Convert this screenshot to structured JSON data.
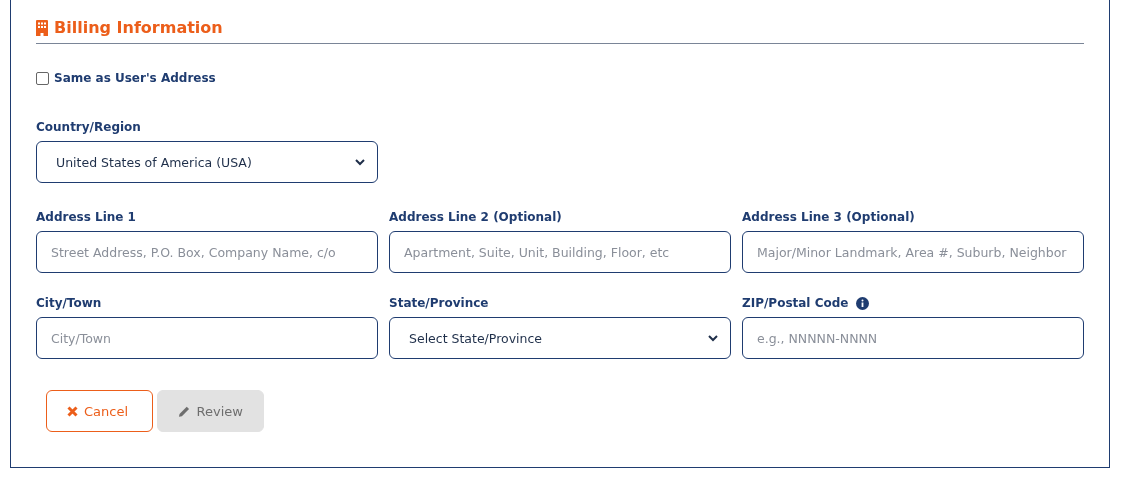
{
  "section": {
    "title": "Billing Information"
  },
  "same_address": {
    "label": "Same as User's Address",
    "checked": false
  },
  "country": {
    "label": "Country/Region",
    "kind": "select",
    "value": "United States of America (USA)"
  },
  "fields": [
    {
      "label": "Address Line 1",
      "kind": "text",
      "placeholder": "Street Address, P.O. Box, Company Name, c/o",
      "info": false
    },
    {
      "label": "Address Line 2 (Optional)",
      "kind": "text",
      "placeholder": "Apartment, Suite, Unit, Building, Floor, etc",
      "info": false
    },
    {
      "label": "Address Line 3 (Optional)",
      "kind": "text",
      "placeholder": "Major/Minor Landmark, Area #, Suburb, Neighbor",
      "info": false
    },
    {
      "label": "City/Town",
      "kind": "text",
      "placeholder": "City/Town",
      "info": false
    },
    {
      "label": "State/Province",
      "kind": "select",
      "value": "Select State/Province",
      "info": false
    },
    {
      "label": "ZIP/Postal Code",
      "kind": "text",
      "placeholder": "e.g., NNNNN-NNNN",
      "info": true
    }
  ],
  "buttons": [
    {
      "label": "Cancel",
      "kind": "cancel",
      "disabled": false
    },
    {
      "label": "Review",
      "kind": "review",
      "disabled": true
    }
  ]
}
